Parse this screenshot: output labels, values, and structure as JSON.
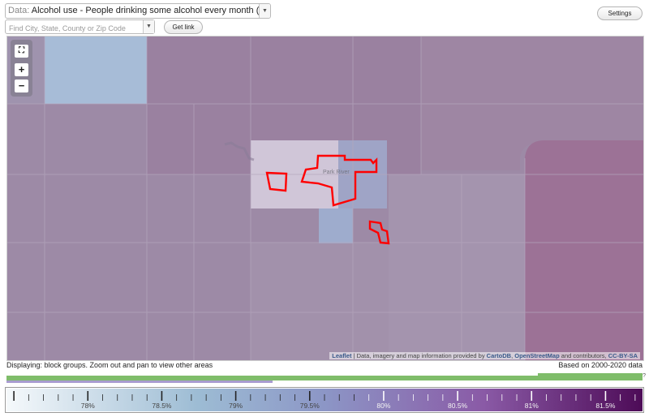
{
  "header": {
    "data_prefix": "Data:",
    "data_value": "Alcohol use - People drinking some alcohol every month (%)",
    "search_placeholder": "Find City, State, County or Zip Code",
    "get_link_label": "Get link",
    "settings_label": "Settings"
  },
  "map": {
    "zoom_fit_symbol": "⛶",
    "zoom_in_symbol": "+",
    "zoom_out_symbol": "−",
    "place_label": "Park River",
    "attribution": {
      "leaflet": "Leaflet",
      "text": " | Data, imagery and map information provided by ",
      "cartodb": "CartoDB",
      "sep": ", ",
      "osm": "OpenStreetMap",
      "tail": " and contributors, ",
      "license": "CC-BY-SA"
    },
    "colors": {
      "base": "#9d8aa6",
      "light_tract": "#a7c2d6",
      "east_tract": "#9c7696",
      "north_tract": "#9a80a0",
      "selected_outline": "#ff0000"
    }
  },
  "status": {
    "displaying": "Displaying: block groups. Zoom out and pan to view other areas",
    "based_on": "Based on 2000-2020 data"
  },
  "coverage": {
    "question_mark": "?",
    "colors": {
      "green": "#7fbd6a",
      "purple": "#a89cd0"
    }
  },
  "legend": {
    "tick_labels": [
      "78%",
      "78.5%",
      "79%",
      "79.5%",
      "80%",
      "80.5%",
      "81%",
      "81.5%"
    ],
    "range_pct": [
      77.45,
      81.75
    ],
    "gradient_colors": [
      "#f5f9fb",
      "#9dbcd4",
      "#8c96c6",
      "#8a5aa6",
      "#4d0b57"
    ]
  }
}
